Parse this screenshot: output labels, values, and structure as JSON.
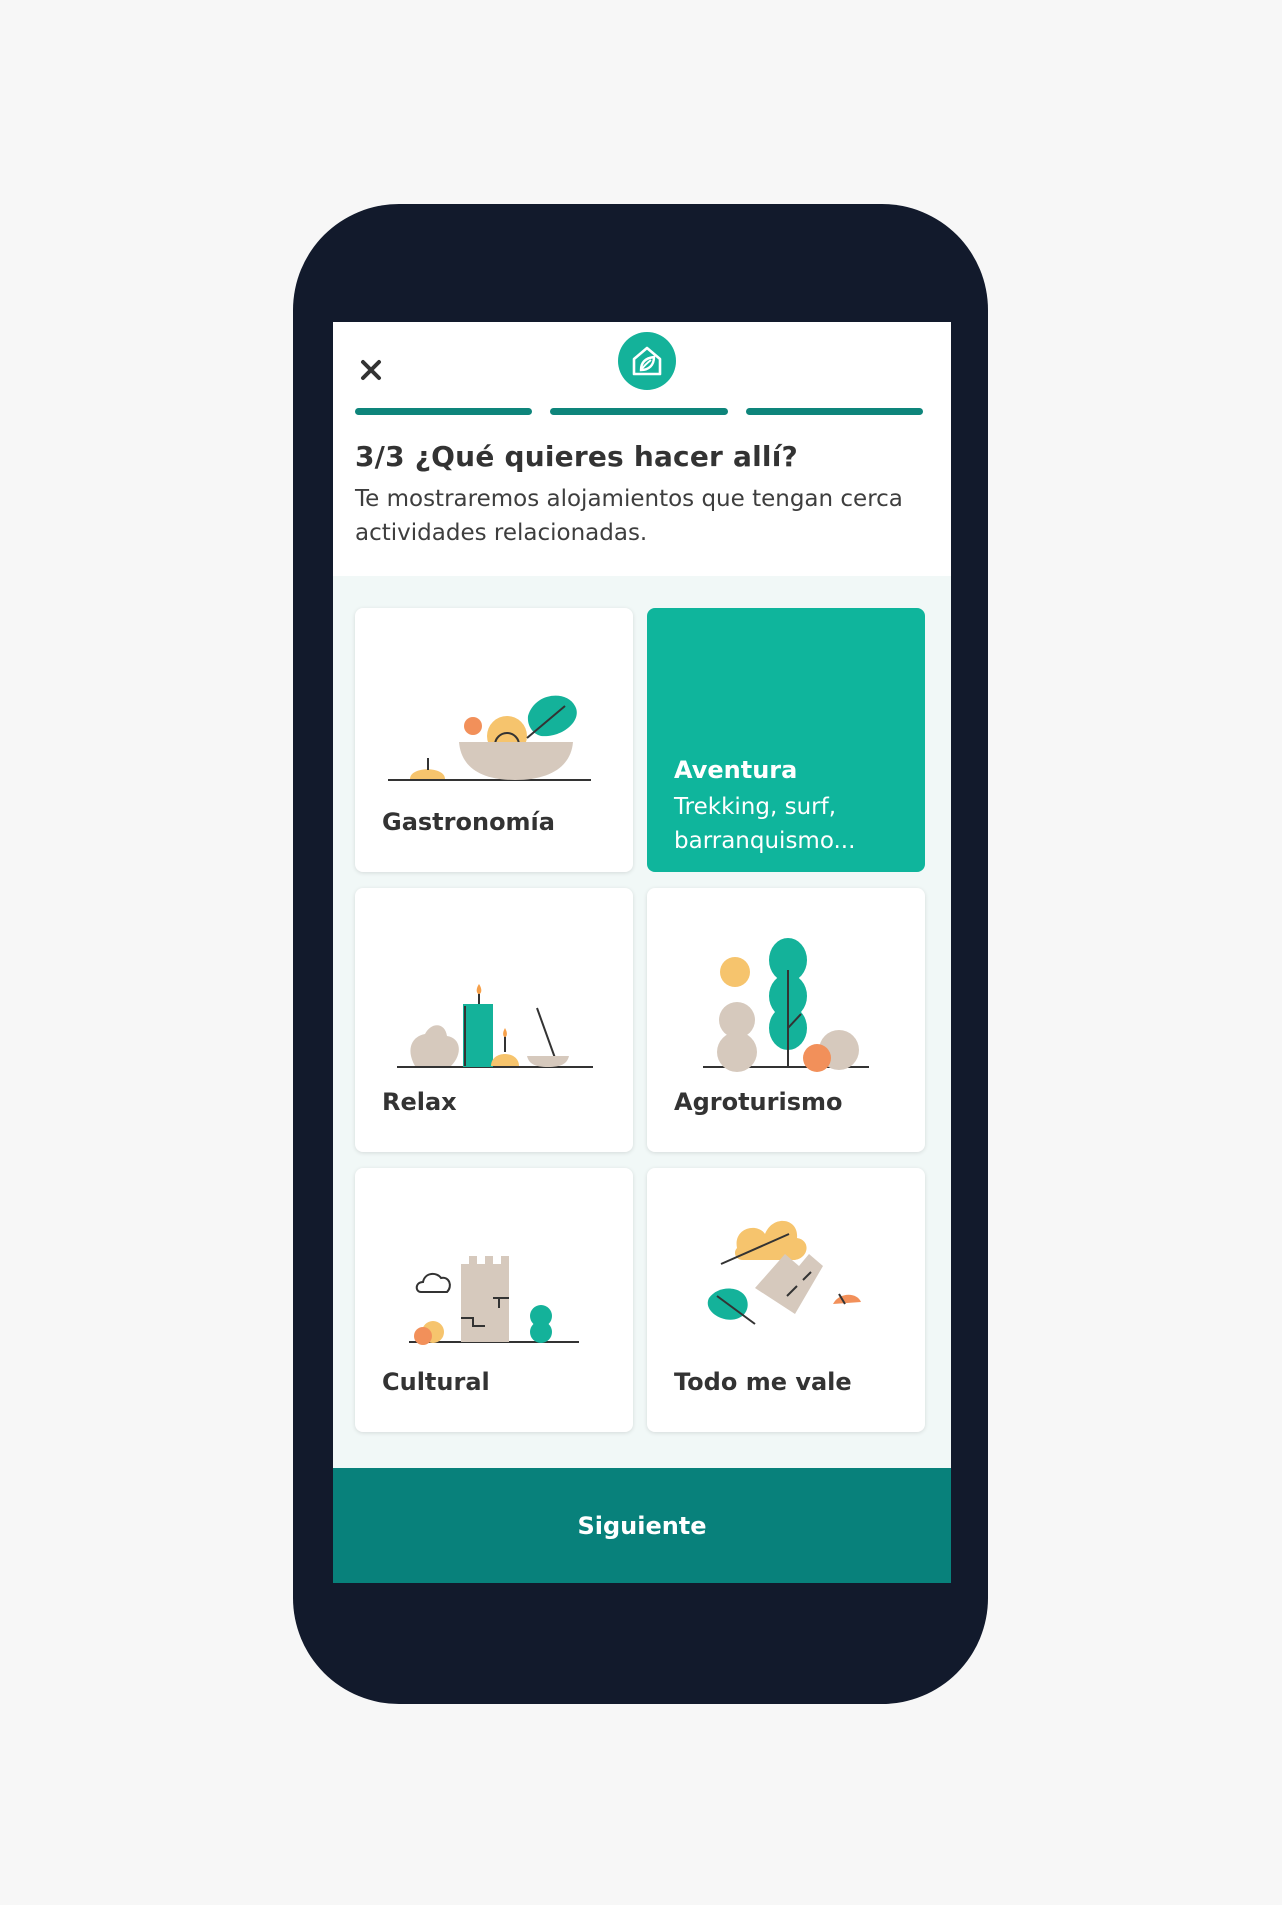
{
  "header": {
    "close_icon": "close-icon",
    "logo_icon": "house-leaf-logo-icon",
    "progress_steps_completed": 3,
    "progress_steps_total": 3,
    "title": "3/3 ¿Qué quieres hacer allí?",
    "subtitle": "Te mostraremos alojamientos que tengan cerca actividades relacionadas."
  },
  "options": [
    {
      "label": "Gastronomía",
      "icon": "food-bowl-illustration",
      "selected": false
    },
    {
      "label": "Aventura",
      "description": "Trekking, surf, barranquismo...",
      "selected": true
    },
    {
      "label": "Relax",
      "icon": "candles-illustration",
      "selected": false
    },
    {
      "label": "Agroturismo",
      "icon": "trees-illustration",
      "selected": false
    },
    {
      "label": "Cultural",
      "icon": "tower-illustration",
      "selected": false
    },
    {
      "label": "Todo me vale",
      "icon": "mixed-illustration",
      "selected": false
    }
  ],
  "footer": {
    "next_label": "Siguiente"
  },
  "colors": {
    "accent": "#0fb59c",
    "progress": "#0e857b",
    "button": "#08817b",
    "phone_frame": "#121a2c",
    "background": "#f1f8f7"
  }
}
